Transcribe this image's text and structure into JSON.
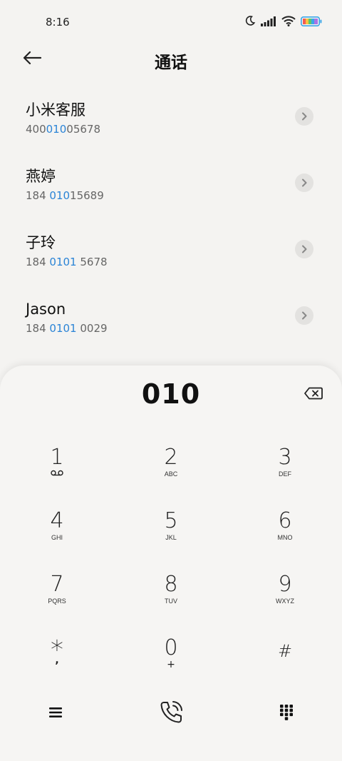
{
  "status": {
    "time": "8:16",
    "icons": [
      "moon-icon",
      "signal-icon",
      "wifi-icon",
      "battery-icon"
    ]
  },
  "header": {
    "title": "通话",
    "back_icon": "arrow-left-icon"
  },
  "contacts": [
    {
      "name": "小米客服",
      "num_pre": "400",
      "num_hl": "010",
      "num_post": "05678"
    },
    {
      "name": "燕婷",
      "num_pre": "184 ",
      "num_hl": "010",
      "num_post": "15689"
    },
    {
      "name": "子玲",
      "num_pre": "184 ",
      "num_hl": "0101",
      "num_post": " 5678"
    },
    {
      "name": "Jason",
      "num_pre": "184 ",
      "num_hl": "0101",
      "num_post": " 0029"
    }
  ],
  "dialpad": {
    "number": "010",
    "keys": [
      {
        "digit": "1",
        "letters": ""
      },
      {
        "digit": "2",
        "letters": "ABC"
      },
      {
        "digit": "3",
        "letters": "DEF"
      },
      {
        "digit": "4",
        "letters": "GHI"
      },
      {
        "digit": "5",
        "letters": "JKL"
      },
      {
        "digit": "6",
        "letters": "MNO"
      },
      {
        "digit": "7",
        "letters": "PQRS"
      },
      {
        "digit": "8",
        "letters": "TUV"
      },
      {
        "digit": "9",
        "letters": "WXYZ"
      },
      {
        "digit": "*",
        "letters": ","
      },
      {
        "digit": "0",
        "letters": "+"
      },
      {
        "digit": "#",
        "letters": ""
      }
    ]
  },
  "colors": {
    "highlight": "#2b84d6",
    "background": "#f4f3f1"
  }
}
